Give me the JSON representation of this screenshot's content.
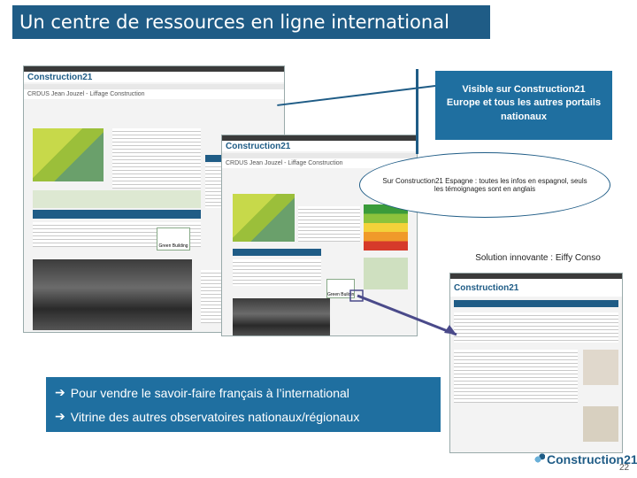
{
  "slide": {
    "title": "Un centre de ressources en ligne international",
    "page_number": "22"
  },
  "screenshots": {
    "main": {
      "logo": "Construction21",
      "heading": "CRDUS Jean Jouzel - Liffage Construction",
      "badge": "Green Building"
    },
    "spain": {
      "logo": "Construction21",
      "heading": "CRDUS Jean Jouzel - Liffage Construction",
      "badge": "Green Building"
    },
    "solution": {
      "logo": "Construction21"
    }
  },
  "callouts": {
    "visible": "Visible sur Construction21 Europe et tous les autres portails nationaux",
    "spain": "Sur Construction21 Espagne : toutes les infos en espagnol, seuls les témoignages sont en anglais",
    "solution": "Solution innovante : Eiffy Conso"
  },
  "bullets": [
    "Pour vendre le savoir-faire français à l’international",
    "Vitrine des autres observatoires nationaux/régionaux"
  ],
  "arrow_glyph": "➔",
  "footer_logo": "Construction21",
  "colors": {
    "brand": "#1f5c86",
    "callout": "#1f6fa0"
  }
}
